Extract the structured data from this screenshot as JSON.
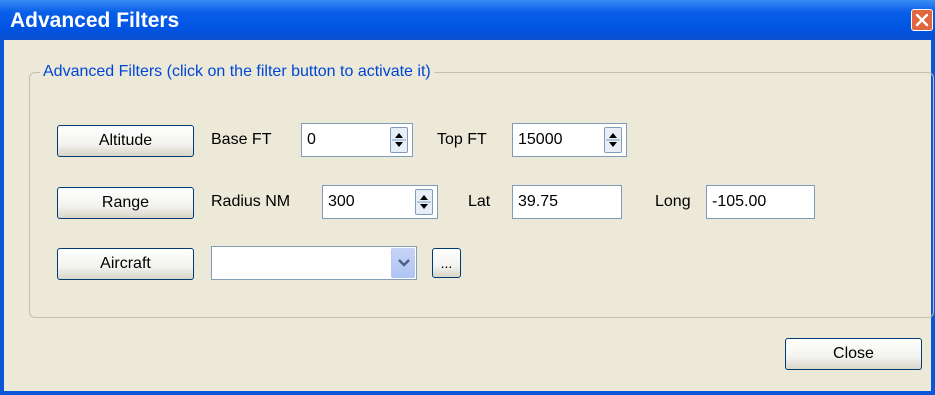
{
  "window": {
    "title": "Advanced Filters"
  },
  "group": {
    "legend": "Advanced Filters (click on the filter button to activate it)"
  },
  "altitude": {
    "button_label": "Altitude",
    "base_label": "Base FT",
    "base_value": "0",
    "top_label": "Top FT",
    "top_value": "15000"
  },
  "range": {
    "button_label": "Range",
    "radius_label": "Radius NM",
    "radius_value": "300",
    "lat_label": "Lat",
    "lat_value": "39.75",
    "long_label": "Long",
    "long_value": "-105.00"
  },
  "aircraft": {
    "button_label": "Aircraft",
    "selected_value": "",
    "browse_label": "..."
  },
  "footer": {
    "close_label": "Close"
  },
  "colors": {
    "titlebar": "#0054e3",
    "legend_text": "#0046d5",
    "background": "#ece9d8",
    "close_icon_bg": "#e0663f"
  },
  "icons": {
    "close": "close-icon",
    "spin": "spinner-arrows-icon",
    "dropdown": "chevron-down-icon"
  }
}
